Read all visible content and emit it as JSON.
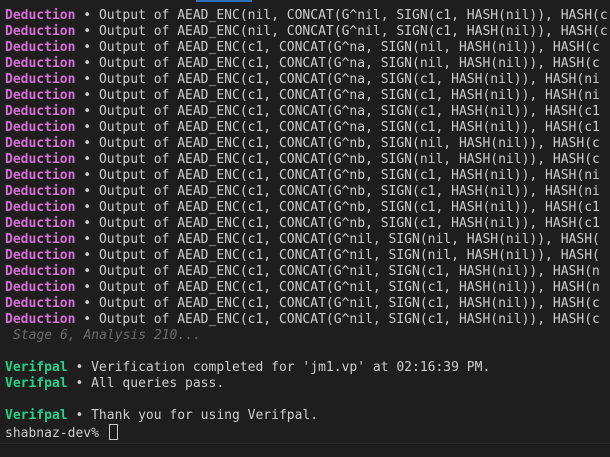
{
  "deductions": {
    "label": "Deduction",
    "separator": " • ",
    "lines": [
      "Output of AEAD_ENC(nil, CONCAT(G^nil, SIGN(c1, HASH(nil)), HASH(c",
      "Output of AEAD_ENC(nil, CONCAT(G^nil, SIGN(c1, HASH(nil)), HASH(c",
      "Output of AEAD_ENC(c1, CONCAT(G^na, SIGN(nil, HASH(nil)), HASH(c",
      "Output of AEAD_ENC(c1, CONCAT(G^na, SIGN(nil, HASH(nil)), HASH(c",
      "Output of AEAD_ENC(c1, CONCAT(G^na, SIGN(c1, HASH(nil)), HASH(ni",
      "Output of AEAD_ENC(c1, CONCAT(G^na, SIGN(c1, HASH(nil)), HASH(ni",
      "Output of AEAD_ENC(c1, CONCAT(G^na, SIGN(c1, HASH(nil)), HASH(c1",
      "Output of AEAD_ENC(c1, CONCAT(G^na, SIGN(c1, HASH(nil)), HASH(c1",
      "Output of AEAD_ENC(c1, CONCAT(G^nb, SIGN(nil, HASH(nil)), HASH(c",
      "Output of AEAD_ENC(c1, CONCAT(G^nb, SIGN(nil, HASH(nil)), HASH(c",
      "Output of AEAD_ENC(c1, CONCAT(G^nb, SIGN(c1, HASH(nil)), HASH(ni",
      "Output of AEAD_ENC(c1, CONCAT(G^nb, SIGN(c1, HASH(nil)), HASH(ni",
      "Output of AEAD_ENC(c1, CONCAT(G^nb, SIGN(c1, HASH(nil)), HASH(c1",
      "Output of AEAD_ENC(c1, CONCAT(G^nb, SIGN(c1, HASH(nil)), HASH(c1",
      "Output of AEAD_ENC(c1, CONCAT(G^nil, SIGN(nil, HASH(nil)), HASH(",
      "Output of AEAD_ENC(c1, CONCAT(G^nil, SIGN(nil, HASH(nil)), HASH(",
      "Output of AEAD_ENC(c1, CONCAT(G^nil, SIGN(c1, HASH(nil)), HASH(n",
      "Output of AEAD_ENC(c1, CONCAT(G^nil, SIGN(c1, HASH(nil)), HASH(n",
      "Output of AEAD_ENC(c1, CONCAT(G^nil, SIGN(c1, HASH(nil)), HASH(c",
      "Output of AEAD_ENC(c1, CONCAT(G^nil, SIGN(c1, HASH(nil)), HASH(c"
    ]
  },
  "stage_status": "Stage 6, Analysis 210...",
  "verifpal": {
    "label": "Verifpal",
    "separator": " • ",
    "completed": "Verification completed for 'jm1.vp' at 02:16:39 PM.",
    "queries": "All queries pass.",
    "thanks": "Thank you for using Verifpal."
  },
  "prompt": "shabnaz-dev% ",
  "colors": {
    "background": "#1e1e1e",
    "deduction": "#d670d6",
    "verifpal": "#23d18b",
    "text": "#cccccc",
    "stage": "#6b6b6b"
  }
}
